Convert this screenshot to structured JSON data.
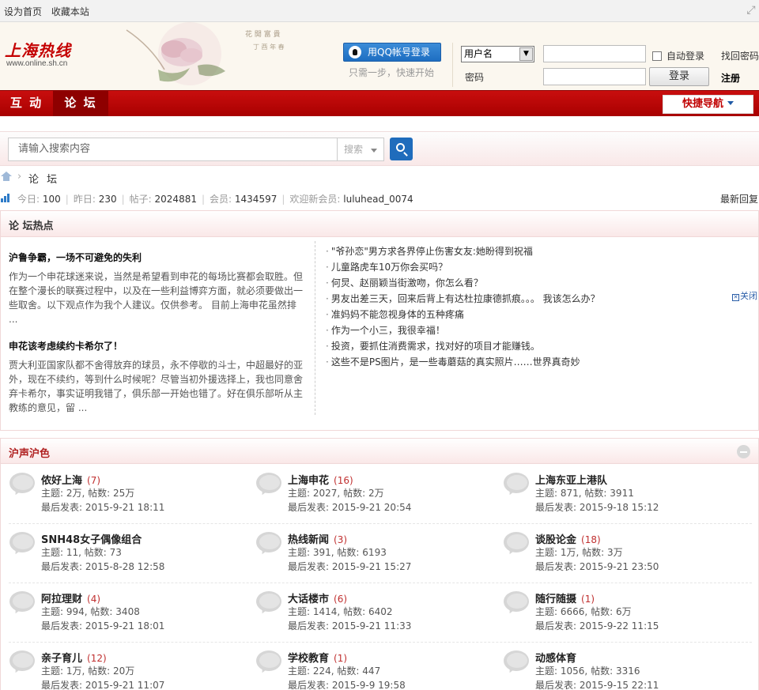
{
  "topbar": {
    "set_home": "设为首页",
    "bookmark": "收藏本站"
  },
  "header": {
    "logo_text": "上海热线",
    "logo_url": "www.online.sh.cn",
    "qq_login": "用QQ帐号登录",
    "qq_tip": "只需一步，快速开始",
    "user_select": "用户名",
    "password_label": "密码",
    "auto_login": "自动登录",
    "login": "登录",
    "find_password": "找回密码",
    "register": "注册"
  },
  "nav": {
    "items": [
      "互 动",
      "论 坛"
    ],
    "active": 1,
    "quick_nav": "快捷导航"
  },
  "search": {
    "placeholder": "请输入搜索内容",
    "type": "搜索"
  },
  "breadcrumb": {
    "current": "论 坛",
    "sep": "›"
  },
  "stats": {
    "today_label": "今日:",
    "today": "100",
    "yesterday_label": "昨日:",
    "yesterday": "230",
    "posts_label": "帖子:",
    "posts": "2024881",
    "members_label": "会员:",
    "members": "1434597",
    "welcome_label": "欢迎新会员:",
    "new_member": "luluhead_0074",
    "latest_reply": "最新回复"
  },
  "hot": {
    "title": "论 坛热点",
    "articles": [
      {
        "title": "沪鲁争霸，一场不可避免的失利",
        "summary": "作为一个申花球迷来说，当然是希望看到申花的每场比赛都会取胜。但在整个漫长的联赛过程中，以及在一些利益博弈方面，就必须要做出一些取舍。以下观点作为我个人建议。仅供参考。 目前上海申花虽然排 ..."
      },
      {
        "title": "申花该考虑续约卡希尔了！",
        "summary": "贾大利亚国家队都不舍得放弃的球员，永不停歇的斗士，中超最好的亚外，现在不续约，等到什么时候呢？尽管当初外援选择上，我也同意舍弃卡希尔，事实证明我错了，俱乐部一开始也错了。好在俱乐部听从主教练的意见，留 ..."
      }
    ],
    "list": [
      "\"爷孙恋\"男方求各界停止伤害女友:她盼得到祝福",
      "儿童路虎车10万你会买吗？",
      "何炅、赵丽颖当街激吻，你怎么看？",
      "男友出差三天，回来后背上有达杜拉康德抓痕。。。 我该怎么办？",
      "准妈妈不能忽视身体的五种疼痛",
      "作为一个小三，我很幸福！",
      "投资，要抓住消费需求，找对好的项目才能赚钱。",
      "这些不是PS图片，是一些毒蘑菇的真实照片……世界真奇妙"
    ],
    "ad_close": "关闭"
  },
  "forums": {
    "title": "沪声沪色",
    "topics_label": "主题:",
    "posts_label": "帖数:",
    "last_label": "最后发表:",
    "items": [
      {
        "name": "侬好上海",
        "count": "(7)",
        "topics": "2万",
        "posts": "25万",
        "last": "2015-9-21 18:11"
      },
      {
        "name": "上海申花",
        "count": "(16)",
        "topics": "2027",
        "posts": "2万",
        "last": "2015-9-21 20:54"
      },
      {
        "name": "上海东亚上港队",
        "count": "",
        "topics": "871",
        "posts": "3911",
        "last": "2015-9-18 15:12"
      },
      {
        "name": "SNH48女子偶像组合",
        "count": "",
        "topics": "11",
        "posts": "73",
        "last": "2015-8-28 12:58"
      },
      {
        "name": "热线新闻",
        "count": "(3)",
        "topics": "391",
        "posts": "6193",
        "last": "2015-9-21 15:27"
      },
      {
        "name": "谈股论金",
        "count": "(18)",
        "topics": "1万",
        "posts": "3万",
        "last": "2015-9-21 23:50"
      },
      {
        "name": "阿拉理财",
        "count": "(4)",
        "topics": "994",
        "posts": "3408",
        "last": "2015-9-21 18:01"
      },
      {
        "name": "大话楼市",
        "count": "(6)",
        "topics": "1414",
        "posts": "6402",
        "last": "2015-9-21 11:33"
      },
      {
        "name": "随行随摄",
        "count": "(1)",
        "topics": "6666",
        "posts": "6万",
        "last": "2015-9-22 11:15"
      },
      {
        "name": "亲子育儿",
        "count": "(12)",
        "topics": "1万",
        "posts": "20万",
        "last": "2015-9-21 11:07"
      },
      {
        "name": "学校教育",
        "count": "(1)",
        "topics": "224",
        "posts": "447",
        "last": "2015-9-9 19:58"
      },
      {
        "name": "动感体育",
        "count": "",
        "topics": "1056",
        "posts": "3316",
        "last": "2015-9-15 22:11"
      }
    ]
  },
  "colors": {
    "brand_red": "#c00000",
    "nav_active": "#8e0000",
    "qq_blue": "#1e6ec2",
    "search_blue": "#1f6cbc"
  }
}
